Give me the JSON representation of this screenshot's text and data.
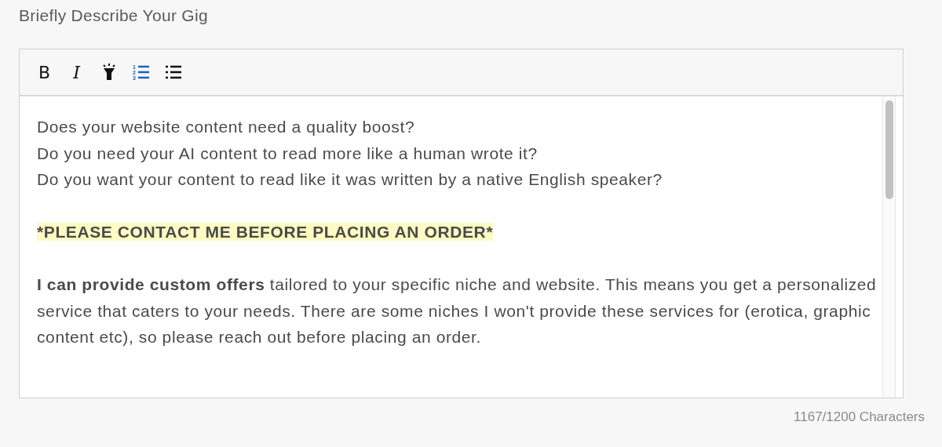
{
  "label": "Briefly Describe Your Gig",
  "toolbar": [
    {
      "kind": "bold",
      "text": "B",
      "selected": false
    },
    {
      "kind": "italic",
      "text": "I",
      "selected": false
    },
    {
      "kind": "highlight",
      "selected": false
    },
    {
      "kind": "ordered-list",
      "digits": [
        "1",
        "2",
        "3"
      ],
      "selected": true
    },
    {
      "kind": "bullet-list",
      "selected": false
    }
  ],
  "paragraphs": [
    {
      "lines": [
        "Does your website content need a quality boost?",
        "Do you need your AI content to read more like a human wrote it?",
        "Do you want your content to read like it was written by a native English speaker?"
      ],
      "highlighted": false
    },
    {
      "lines": [
        "*PLEASE CONTACT ME BEFORE PLACING AN ORDER*"
      ],
      "highlighted": true
    },
    {
      "lines": [
        "**I can provide custom offers** tailored to your specific niche and website. This means you get a personalized service that caters to your needs. There are some niches I won't provide these services for (erotica, graphic content etc), so please reach out before placing an order."
      ],
      "highlighted": false
    }
  ],
  "counter": "1167/1200 Characters"
}
